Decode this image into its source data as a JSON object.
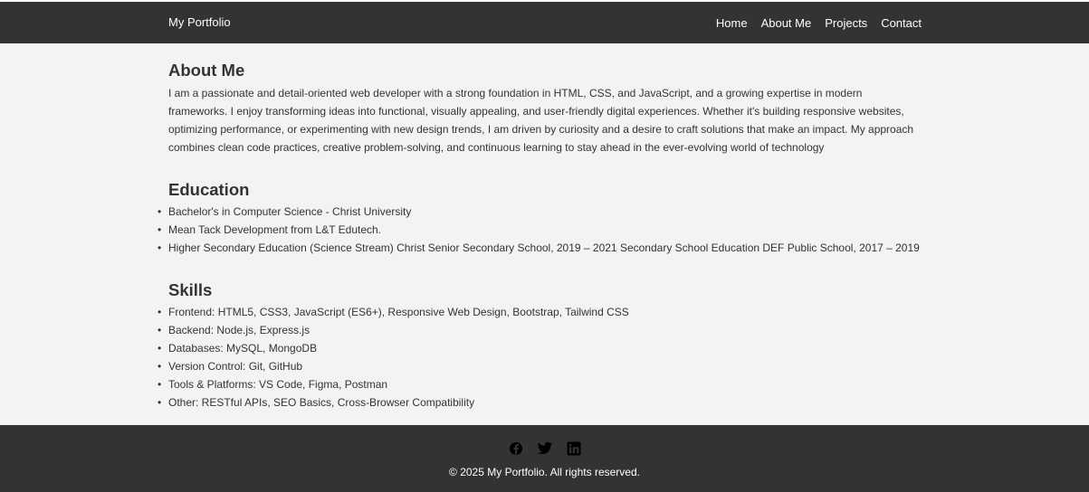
{
  "header": {
    "brand": "My Portfolio",
    "nav": [
      {
        "label": "Home"
      },
      {
        "label": "About Me"
      },
      {
        "label": "Projects"
      },
      {
        "label": "Contact"
      }
    ]
  },
  "about": {
    "heading": "About Me",
    "text": "I am a passionate and detail-oriented web developer with a strong foundation in HTML, CSS, and JavaScript, and a growing expertise in modern frameworks. I enjoy transforming ideas into functional, visually appealing, and user-friendly digital experiences. Whether it's building responsive websites, optimizing performance, or experimenting with new design trends, I am driven by curiosity and a desire to craft solutions that make an impact. My approach combines clean code practices, creative problem-solving, and continuous learning to stay ahead in the ever-evolving world of technology"
  },
  "education": {
    "heading": "Education",
    "items": [
      "Bachelor's in Computer Science - Christ University",
      "Mean Tack Development from L&T Edutech.",
      "Higher Secondary Education (Science Stream) Christ Senior Secondary School, 2019 – 2021 Secondary School Education DEF Public School, 2017 – 2019"
    ]
  },
  "skills": {
    "heading": "Skills",
    "items": [
      "Frontend: HTML5, CSS3, JavaScript (ES6+), Responsive Web Design, Bootstrap, Tailwind CSS",
      "Backend: Node.js, Express.js",
      "Databases: MySQL, MongoDB",
      "Version Control: Git, GitHub",
      "Tools & Platforms: VS Code, Figma, Postman",
      "Other: RESTful APIs, SEO Basics, Cross-Browser Compatibility"
    ]
  },
  "footer": {
    "social": [
      "facebook-icon",
      "twitter-icon",
      "linkedin-icon"
    ],
    "copyright": "© 2025 My Portfolio. All rights reserved."
  },
  "colors": {
    "header_bg": "#333333",
    "page_bg": "#f3f3f3",
    "text": "#333333",
    "icon": "#000000"
  }
}
